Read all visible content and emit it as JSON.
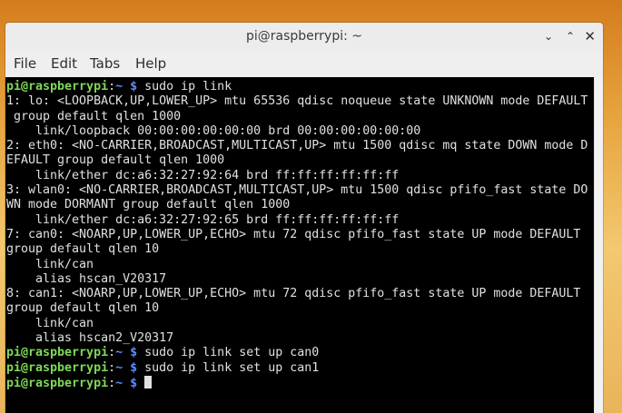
{
  "window": {
    "title": "pi@raspberrypi: ~",
    "controls": {
      "minimize": "⌄",
      "maximize": "⌃",
      "close": "✕"
    }
  },
  "menu": {
    "file": "File",
    "edit": "Edit",
    "tabs": "Tabs",
    "help": "Help"
  },
  "prompt": {
    "user_host": "pi@raspberrypi",
    "colon": ":",
    "path": "~ $"
  },
  "terminal": {
    "cmd1": " sudo ip link",
    "out": [
      "1: lo: <LOOPBACK,UP,LOWER_UP> mtu 65536 qdisc noqueue state UNKNOWN mode DEFAULT",
      " group default qlen 1000",
      "    link/loopback 00:00:00:00:00:00 brd 00:00:00:00:00:00",
      "2: eth0: <NO-CARRIER,BROADCAST,MULTICAST,UP> mtu 1500 qdisc mq state DOWN mode D",
      "EFAULT group default qlen 1000",
      "    link/ether dc:a6:32:27:92:64 brd ff:ff:ff:ff:ff:ff",
      "3: wlan0: <NO-CARRIER,BROADCAST,MULTICAST,UP> mtu 1500 qdisc pfifo_fast state DO",
      "WN mode DORMANT group default qlen 1000",
      "    link/ether dc:a6:32:27:92:65 brd ff:ff:ff:ff:ff:ff",
      "7: can0: <NOARP,UP,LOWER_UP,ECHO> mtu 72 qdisc pfifo_fast state UP mode DEFAULT",
      "group default qlen 10",
      "    link/can",
      "    alias hscan_V20317",
      "8: can1: <NOARP,UP,LOWER_UP,ECHO> mtu 72 qdisc pfifo_fast state UP mode DEFAULT",
      "group default qlen 10",
      "    link/can",
      "    alias hscan2_V20317"
    ],
    "cmd2": " sudo ip link set up can0",
    "cmd3": " sudo ip link set up can1"
  }
}
